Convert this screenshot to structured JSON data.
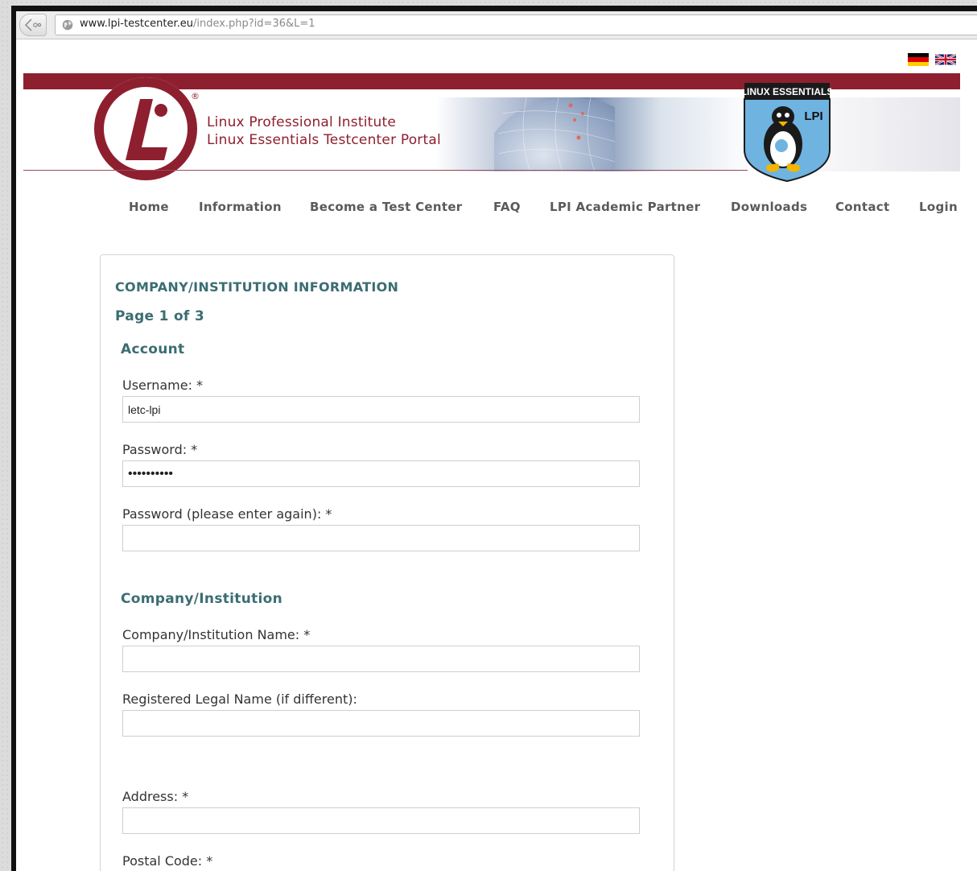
{
  "browser": {
    "url_domain": "www.lpi-testcenter.eu",
    "url_path": "/index.php?id=36&L=1"
  },
  "header": {
    "org_name": "Linux Professional Institute",
    "portal_name": "Linux Essentials Testcenter Portal",
    "registered_mark": "®",
    "badge_title": "LINUX ESSENTIALS",
    "badge_lpi": "LPI"
  },
  "nav": {
    "items": [
      "Home",
      "Information",
      "Become a Test Center",
      "FAQ",
      "LPI Academic Partner",
      "Downloads",
      "Contact",
      "Login"
    ]
  },
  "form": {
    "section_title": "COMPANY/INSTITUTION INFORMATION",
    "page_indicator": "Page 1 of 3",
    "account_heading": "Account",
    "username_label": "Username: *",
    "username_value": "letc-lpi",
    "password_label": "Password: *",
    "password_value": "••••••••••",
    "password_again_label": "Password (please enter again): *",
    "password_again_value": "",
    "company_heading": "Company/Institution",
    "company_name_label": "Company/Institution Name: *",
    "company_name_value": "",
    "legal_name_label": "Registered Legal Name (if different):",
    "legal_name_value": "",
    "address_label": "Address: *",
    "address_value": "",
    "postal_code_label": "Postal Code: *"
  },
  "colors": {
    "brand_red": "#8e1f2f",
    "heading_teal": "#3b6d72",
    "nav_gray": "#5a5a5a"
  },
  "icons": [
    "back-arrow-icon",
    "globe-icon",
    "german-flag-icon",
    "uk-flag-icon",
    "lpi-logo-icon",
    "tux-penguin-icon"
  ]
}
